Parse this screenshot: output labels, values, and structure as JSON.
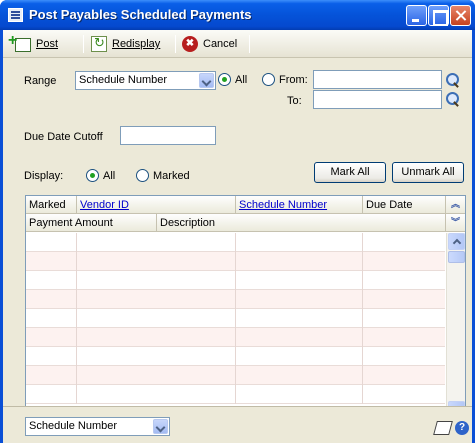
{
  "window": {
    "title": "Post Payables Scheduled Payments"
  },
  "toolbar": {
    "post_label": "Post",
    "redisplay_label": "Redisplay",
    "cancel_label": "Cancel"
  },
  "form": {
    "range_label": "Range",
    "range_value": "Schedule Number",
    "all_label": "All",
    "from_label": "From:",
    "to_label": "To:",
    "from_value": "",
    "to_value": "",
    "due_date_label": "Due Date Cutoff",
    "due_date_value": "",
    "display_label": "Display:",
    "display_all_label": "All",
    "display_marked_label": "Marked",
    "mark_all_label": "Mark All",
    "unmark_all_label": "Unmark All",
    "selected_range_option": "All",
    "selected_display_option": "All"
  },
  "grid": {
    "header_row1": [
      "Marked",
      "Vendor ID",
      "Schedule Number",
      "Due Date"
    ],
    "header_row2": [
      "Payment Amount",
      "Description"
    ],
    "expand_glyph": "≈",
    "collapse_glyph": "≈",
    "row_count": 9
  },
  "statusbar": {
    "sort_value": "Schedule Number"
  },
  "icons": {
    "post": "post-icon",
    "redisplay": "redisplay-icon",
    "cancel": "cancel-icon",
    "lookup": "lookup-icon",
    "note": "note-icon",
    "help": "help-icon"
  },
  "colors": {
    "titlebar": "#0553d9",
    "dialog_background": "#ece9d8",
    "link": "#0000cc",
    "row_alt": "#fdf2f0"
  }
}
